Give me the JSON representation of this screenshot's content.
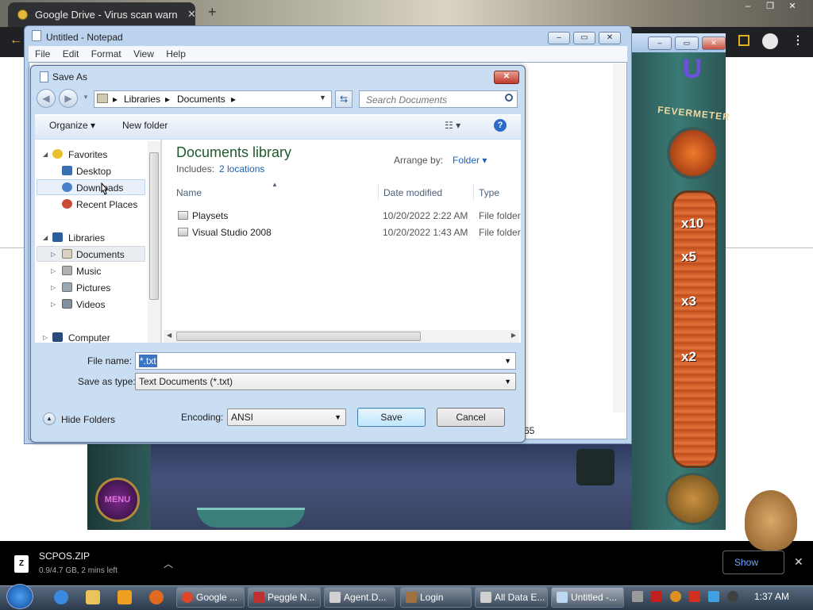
{
  "chrome": {
    "tab_title": "Google Drive - Virus scan warnin",
    "close_glyph": "✕",
    "new_tab_glyph": "+"
  },
  "game": {
    "menu_label": "MENU",
    "fevermeter_label": "FEVERMETER",
    "multipliers": [
      "x10",
      "x5",
      "x3",
      "x2"
    ]
  },
  "notepad": {
    "title": "Untitled - Notepad",
    "menu": [
      "File",
      "Edit",
      "Format",
      "View",
      "Help"
    ],
    "status_text": "65"
  },
  "dialog": {
    "title": "Save As",
    "breadcrumb": [
      "Libraries",
      "Documents"
    ],
    "search_placeholder": "Search Documents",
    "toolbar": {
      "organize": "Organize ▾",
      "new_folder": "New folder"
    },
    "nav": {
      "favorites_header": "Favorites",
      "favorites": [
        "Desktop",
        "Downloads",
        "Recent Places"
      ],
      "libraries_header": "Libraries",
      "libraries": [
        "Documents",
        "Music",
        "Pictures",
        "Videos"
      ],
      "computer": "Computer"
    },
    "library": {
      "title": "Documents library",
      "includes_label": "Includes:",
      "includes_link": "2 locations",
      "arrange_label": "Arrange by:",
      "arrange_value": "Folder ▾"
    },
    "columns": [
      "Name",
      "Date modified",
      "Type"
    ],
    "files": [
      {
        "name": "Playsets",
        "date": "10/20/2022 2:22 AM",
        "type": "File folder"
      },
      {
        "name": "Visual Studio 2008",
        "date": "10/20/2022 1:43 AM",
        "type": "File folder"
      }
    ],
    "file_name_label": "File name:",
    "file_name_value": "*.txt",
    "save_as_type_label": "Save as type:",
    "save_as_type_value": "Text Documents (*.txt)",
    "hide_folders": "Hide Folders",
    "encoding_label": "Encoding:",
    "encoding_value": "ANSI",
    "save_button": "Save",
    "cancel_button": "Cancel"
  },
  "downloads": {
    "file_name": "SCPOS.ZIP",
    "status": "0.9/4.7 GB, 2 mins left",
    "show_all": "Show"
  },
  "taskbar": {
    "buttons": [
      "Google ...",
      "Peggle N...",
      "Agent.D...",
      "Login",
      "All Data E...",
      "Untitled -..."
    ],
    "clock": "1:37 AM"
  },
  "colors": {
    "library_title": "#1e5a2e",
    "link": "#1f5fb2",
    "selection": "#3b75c4",
    "dialog_frame": "#c9ddf3"
  }
}
